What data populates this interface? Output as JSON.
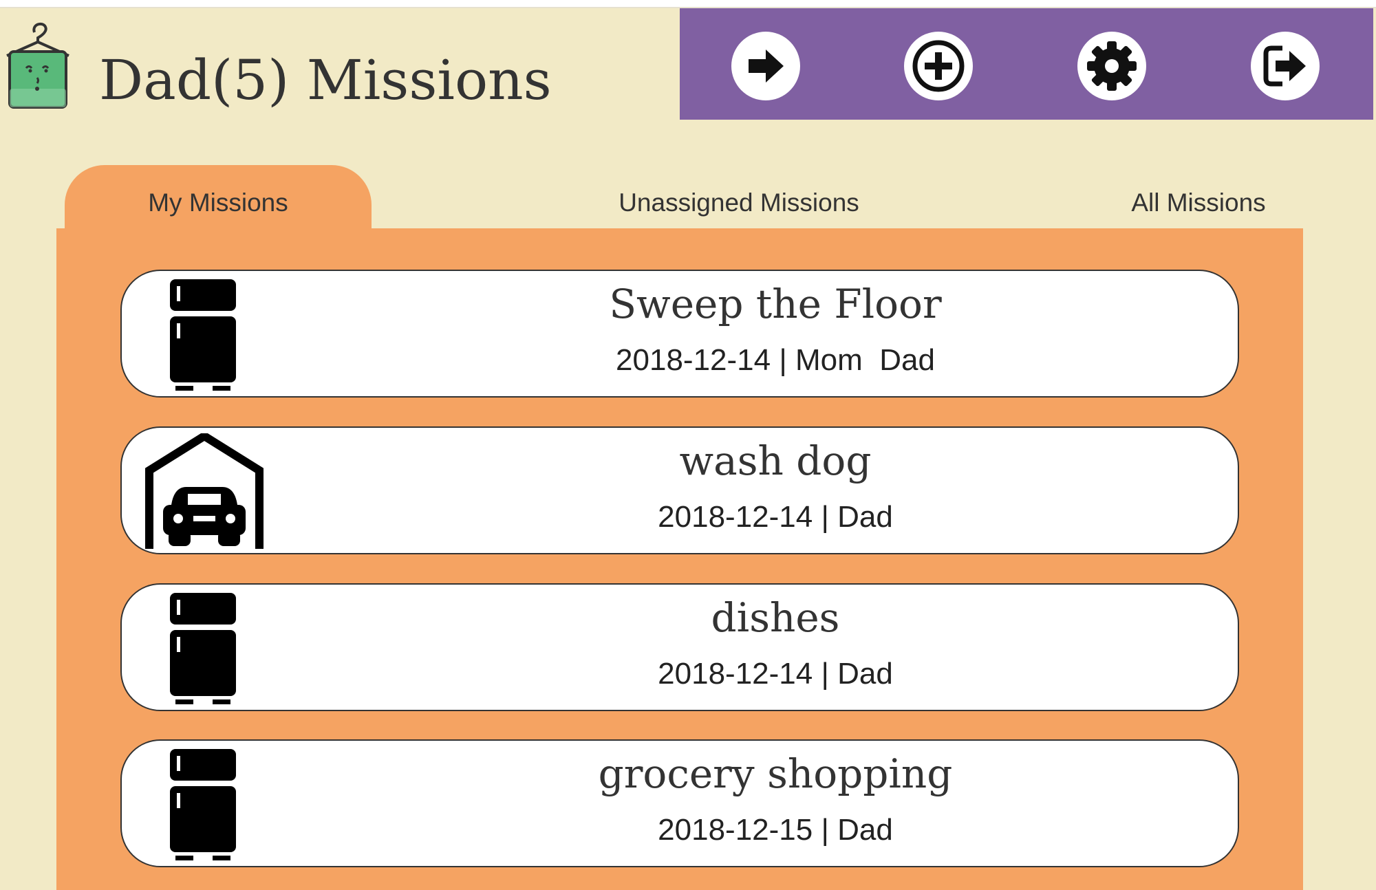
{
  "header": {
    "title": "Dad(5) Missions",
    "logo_icon": "hanger-laundry-face-icon"
  },
  "toolbar": {
    "buttons": [
      {
        "name": "next",
        "icon": "arrow-right-icon"
      },
      {
        "name": "add",
        "icon": "plus-circle-icon"
      },
      {
        "name": "settings",
        "icon": "gear-icon"
      },
      {
        "name": "logout",
        "icon": "sign-out-icon"
      }
    ],
    "color": "#8060a2"
  },
  "tabs": [
    {
      "label": "My Missions",
      "active": true
    },
    {
      "label": "Unassigned Missions",
      "active": false
    },
    {
      "label": "All Missions",
      "active": false
    }
  ],
  "missions": [
    {
      "title": "Sweep the Floor",
      "meta": "2018-12-14 | Mom  Dad",
      "icon": "refrigerator-icon"
    },
    {
      "title": "wash dog",
      "meta": "2018-12-14 | Dad",
      "icon": "garage-car-icon"
    },
    {
      "title": "dishes",
      "meta": "2018-12-14 | Dad",
      "icon": "refrigerator-icon"
    },
    {
      "title": "grocery shopping",
      "meta": "2018-12-15 | Dad",
      "icon": "refrigerator-icon"
    }
  ],
  "colors": {
    "background": "#f2eac6",
    "accent": "#f5a362",
    "toolbar": "#8060a2",
    "card": "#ffffff"
  }
}
